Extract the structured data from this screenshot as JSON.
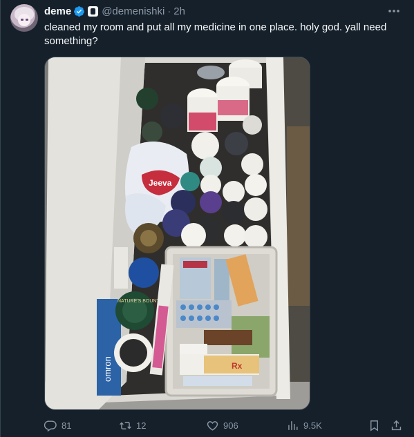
{
  "post": {
    "author_name": "deme",
    "handle": "@demenishki",
    "separator": "·",
    "time": "2h",
    "text": "cleaned my room and put all my medicine in one place. holy god. yall need something?"
  },
  "actions": {
    "replies": "81",
    "reposts": "12",
    "likes": "906",
    "views": "9.5K"
  },
  "photo_labels": {
    "cotton_bag": "Jeeva",
    "bottle_brand": "NATURE'S BOUNTY",
    "box_brand": "omron",
    "tube_mark": "Rx"
  },
  "icons": {
    "verified": "verified-badge-icon",
    "affiliate": "affiliate-badge-icon",
    "more": "more-horizontal-icon",
    "reply": "reply-icon",
    "repost": "repost-icon",
    "like": "heart-icon",
    "views": "views-chart-icon",
    "bookmark": "bookmark-icon",
    "share": "share-icon"
  },
  "colors": {
    "background": "#15202b",
    "muted_text": "#8b98a5",
    "verified_blue": "#1d9bf0"
  }
}
